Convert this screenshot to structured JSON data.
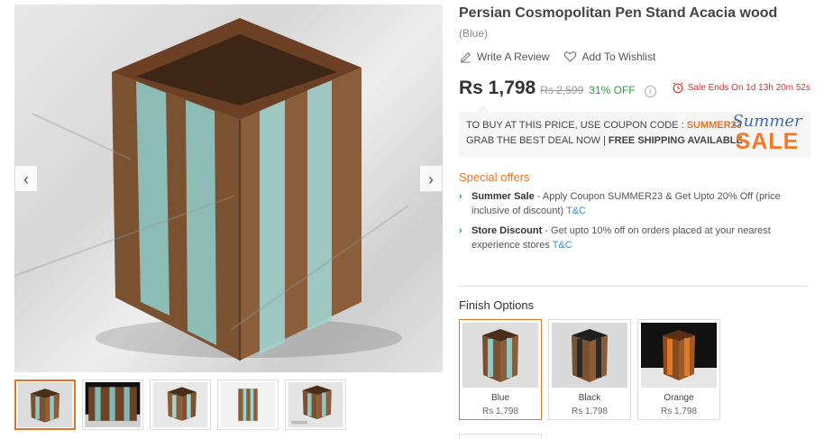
{
  "product": {
    "title": "Persian Cosmopolitan Pen Stand Acacia wood",
    "variant": "(Blue)",
    "write_review": "Write A Review",
    "add_wishlist": "Add To Wishlist"
  },
  "pricing": {
    "price": "Rs 1,798",
    "mrp": "Rs 2,599",
    "discount": "31% OFF",
    "info": "i",
    "sale_ends": "Sale Ends On 1d 13h 20m 52s"
  },
  "coupon": {
    "line1_prefix": "TO BUY AT THIS PRICE, USE COUPON CODE : ",
    "code": "SUMMER23",
    "line2_prefix": "GRAB THE BEST DEAL NOW | ",
    "line2_bold": "FREE SHIPPING AVAILABLE",
    "logo_summer": "Summer",
    "logo_sale": "SALE"
  },
  "offers": {
    "title": "Special offers",
    "items": [
      {
        "name": "Summer Sale",
        "text": " - Apply Coupon SUMMER23 & Get Upto 20% Off (price inclusive of discount) ",
        "link": "T&C"
      },
      {
        "name": "Store Discount",
        "text": " - Get upto 10% off on orders placed at your nearest experience stores ",
        "link": "T&C"
      }
    ]
  },
  "finish": {
    "title": "Finish Options",
    "options": [
      {
        "name": "Blue",
        "price": "Rs 1,798"
      },
      {
        "name": "Black",
        "price": "Rs 1,798"
      },
      {
        "name": "Orange",
        "price": "Rs 1,798"
      }
    ]
  },
  "gallery": {
    "prev_arrow": "‹",
    "next_arrow": "›",
    "selected_index": 0,
    "thumbnail_count": 5
  },
  "colors": {
    "accent": "#e0762c",
    "discount_green": "#2a9d3c",
    "sale_red": "#d0312d",
    "link_blue": "#3b8bd0",
    "wood": "#7a5232",
    "resin_teal": "#6fb3b0"
  }
}
